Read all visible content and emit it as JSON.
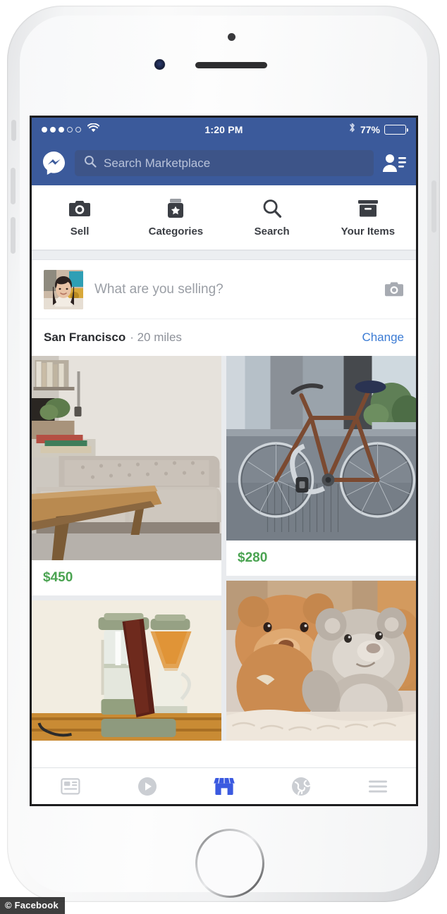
{
  "device": {
    "name": "iphone-white",
    "home_button": "home-button",
    "hardware": [
      "silent-switch",
      "volume-up-button",
      "volume-down-button",
      "power-button",
      "front-camera",
      "earpiece-speaker",
      "proximity-sensor"
    ]
  },
  "status_bar": {
    "signal_filled": 3,
    "signal_total": 5,
    "wifi_icon": "wifi-icon",
    "time": "1:20 PM",
    "bluetooth_icon": "bluetooth-icon",
    "battery_percent": "77%",
    "battery_level": 75
  },
  "header": {
    "messenger_icon": "messenger-icon",
    "friends_icon": "friend-requests-icon",
    "search": {
      "icon": "search-icon",
      "placeholder": "Search Marketplace",
      "value": ""
    },
    "background_color": "#3b5a9b"
  },
  "tabs": [
    {
      "label": "Sell",
      "icon": "camera-icon"
    },
    {
      "label": "Categories",
      "icon": "categories-jar-star-icon"
    },
    {
      "label": "Search",
      "icon": "magnifier-icon"
    },
    {
      "label": "Your Items",
      "icon": "box-icon"
    }
  ],
  "composer": {
    "avatar": "user-avatar",
    "placeholder": "What are you selling?",
    "value": "",
    "camera_icon": "camera-icon"
  },
  "location": {
    "city": "San Francisco",
    "distance": "· 20 miles",
    "change_label": "Change",
    "link_color": "#3b7bd4"
  },
  "listings": [
    {
      "id": "sofa",
      "price": "$450",
      "image": "gray-tufted-sofa-with-coffee-table",
      "column": "left"
    },
    {
      "id": "coffee-maker",
      "price": "",
      "image": "pour-over-coffee-maker",
      "column": "left"
    },
    {
      "id": "bicycle",
      "price": "$280",
      "image": "brown-road-bicycle",
      "column": "right"
    },
    {
      "id": "teddy-bears",
      "price": "",
      "image": "brown-and-gray-teddy-bears",
      "column": "right"
    }
  ],
  "price_color": "#4aa351",
  "bottom_tabs": [
    {
      "name": "news-feed",
      "icon": "newsfeed-icon",
      "active": false
    },
    {
      "name": "watch",
      "icon": "play-circle-icon",
      "active": false
    },
    {
      "name": "marketplace",
      "icon": "storefront-icon",
      "active": true
    },
    {
      "name": "notifications",
      "icon": "globe-icon",
      "active": false
    },
    {
      "name": "menu",
      "icon": "hamburger-menu-icon",
      "active": false
    }
  ],
  "active_tab_color": "#3b5ae0",
  "watermark": "© Facebook"
}
